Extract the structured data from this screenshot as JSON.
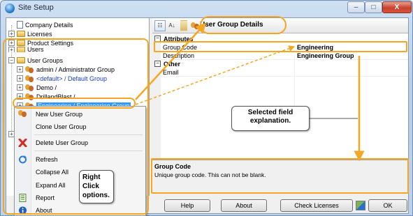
{
  "window": {
    "title": "Site Setup",
    "minimize_glyph": "‒",
    "maximize_glyph": "□",
    "close_glyph": "X"
  },
  "tree": {
    "items": [
      {
        "label": "Company Details",
        "icon": "document-icon",
        "expander": ""
      },
      {
        "label": "Licenses",
        "icon": "folder-icon",
        "expander": "+"
      },
      {
        "label": "Product Settings",
        "icon": "folder-icon",
        "expander": "+"
      },
      {
        "label": "Users",
        "icon": "folder-icon",
        "expander": "+"
      },
      {
        "label": "User Groups",
        "icon": "folder-icon",
        "expander": "−"
      },
      {
        "label": "admin / Administrator Group",
        "icon": "users-icon",
        "expander": "+"
      },
      {
        "label": "<default> / Default Group",
        "icon": "users-icon",
        "expander": "+"
      },
      {
        "label": "Demo /",
        "icon": "users-icon",
        "expander": "+"
      },
      {
        "label": "DrillandBlast /",
        "icon": "users-icon",
        "expander": "+"
      },
      {
        "label": "Engineering / Engineering Group",
        "icon": "users-icon",
        "expander": "+"
      }
    ],
    "collapsed_node_expander": "+"
  },
  "context_menu": {
    "items": [
      {
        "label": "New User Group",
        "icon": "users-icon"
      },
      {
        "label": "Clone User Group",
        "icon": ""
      },
      {
        "label": "Delete User Group",
        "icon": "delete-x-icon"
      },
      {
        "label": "Refresh",
        "icon": "refresh-icon"
      },
      {
        "label": "Collapse All",
        "icon": ""
      },
      {
        "label": "Expand All",
        "icon": ""
      },
      {
        "label": "Report",
        "icon": "report-icon"
      },
      {
        "label": "About",
        "icon": "info-icon"
      }
    ]
  },
  "toolbar": {
    "title": "User Group Details",
    "categorized_glyph": "☷",
    "sort_glyph": "A↓"
  },
  "properties": {
    "categories": [
      {
        "name": "Attributes",
        "expander": "−"
      },
      {
        "name": "Other",
        "expander": "−"
      }
    ],
    "rows": [
      {
        "name": "Group Code",
        "value": "Engineering"
      },
      {
        "name": "Description",
        "value": "Engineering Group"
      },
      {
        "name": "Email",
        "value": ""
      }
    ]
  },
  "description_panel": {
    "title": "Group Code",
    "text": "Unique group code. This can not be blank."
  },
  "buttons": {
    "help": "Help",
    "about": "About",
    "check_licenses": "Check Licenses",
    "ok": "OK"
  },
  "annotations": {
    "right_click": "Right Click options.",
    "selected_field": "Selected field explanation."
  },
  "colors": {
    "annotation_orange": "#f5a623",
    "selection_blue": "#3399ff",
    "link_blue": "#1a3cc8"
  }
}
